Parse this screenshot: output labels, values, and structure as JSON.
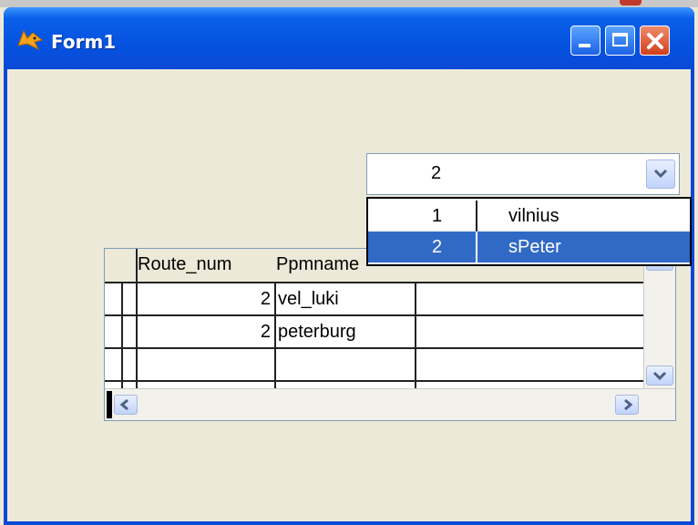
{
  "window": {
    "title": "Form1"
  },
  "combo": {
    "value": "2",
    "options": [
      {
        "num": "1",
        "name": "vilnius",
        "selected": false
      },
      {
        "num": "2",
        "name": "sPeter",
        "selected": true
      }
    ]
  },
  "grid": {
    "columns": [
      "Route_num",
      "Ppmname"
    ],
    "rows": [
      {
        "route_num": "2",
        "ppmname": "vel_luki"
      },
      {
        "route_num": "2",
        "ppmname": "peterburg"
      }
    ]
  },
  "colors": {
    "selection": "#316ac5",
    "titlebar": "#0a5fe8",
    "client": "#ece9d8"
  }
}
